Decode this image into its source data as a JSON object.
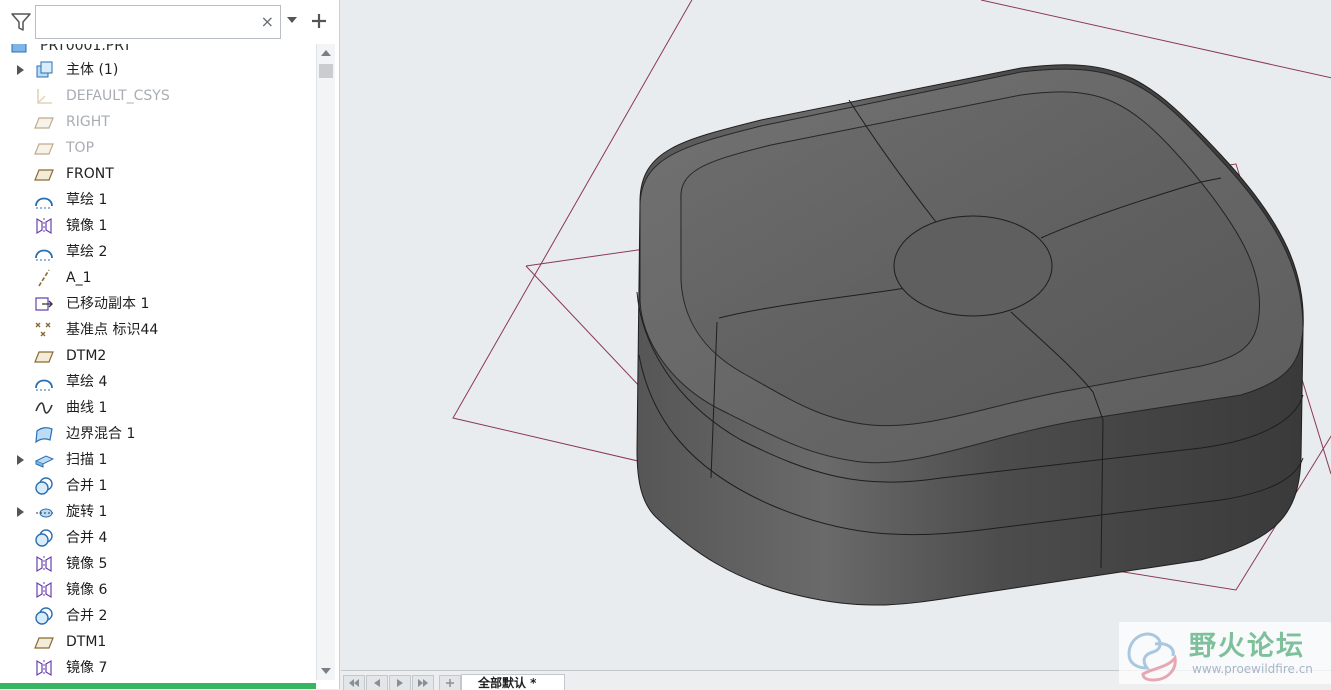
{
  "filter": {
    "search_placeholder": "",
    "clear_glyph": "×"
  },
  "tree": {
    "root_label": "PRT0001.PRT",
    "items": [
      {
        "label": "主体 (1)",
        "icon": "body-icon",
        "expandable": true,
        "dim": false
      },
      {
        "label": "DEFAULT_CSYS",
        "icon": "csys-icon",
        "expandable": false,
        "dim": true
      },
      {
        "label": "RIGHT",
        "icon": "datum-plane-icon",
        "expandable": false,
        "dim": true
      },
      {
        "label": "TOP",
        "icon": "datum-plane-icon",
        "expandable": false,
        "dim": true
      },
      {
        "label": "FRONT",
        "icon": "datum-plane-icon",
        "expandable": false,
        "dim": false
      },
      {
        "label": "草绘 1",
        "icon": "sketch-icon",
        "expandable": false,
        "dim": false
      },
      {
        "label": "镜像 1",
        "icon": "mirror-icon",
        "expandable": false,
        "dim": false
      },
      {
        "label": "草绘 2",
        "icon": "sketch-icon",
        "expandable": false,
        "dim": false
      },
      {
        "label": "A_1",
        "icon": "axis-icon",
        "expandable": false,
        "dim": false
      },
      {
        "label": "已移动副本 1",
        "icon": "moved-copy-icon",
        "expandable": false,
        "dim": false
      },
      {
        "label": "基准点 标识44",
        "icon": "datum-point-icon",
        "expandable": false,
        "dim": false
      },
      {
        "label": "DTM2",
        "icon": "datum-plane-icon",
        "expandable": false,
        "dim": false
      },
      {
        "label": "草绘 4",
        "icon": "sketch-icon",
        "expandable": false,
        "dim": false
      },
      {
        "label": "曲线 1",
        "icon": "curve-icon",
        "expandable": false,
        "dim": false
      },
      {
        "label": "边界混合 1",
        "icon": "boundary-blend-icon",
        "expandable": false,
        "dim": false
      },
      {
        "label": "扫描 1",
        "icon": "sweep-icon",
        "expandable": true,
        "dim": false
      },
      {
        "label": "合并 1",
        "icon": "merge-icon",
        "expandable": false,
        "dim": false
      },
      {
        "label": "旋转 1",
        "icon": "revolve-icon",
        "expandable": true,
        "dim": false
      },
      {
        "label": "合并 4",
        "icon": "merge-icon",
        "expandable": false,
        "dim": false
      },
      {
        "label": "镜像 5",
        "icon": "mirror-icon",
        "expandable": false,
        "dim": false
      },
      {
        "label": "镜像 6",
        "icon": "mirror-icon",
        "expandable": false,
        "dim": false
      },
      {
        "label": "合并 2",
        "icon": "merge-icon",
        "expandable": false,
        "dim": false
      },
      {
        "label": "DTM1",
        "icon": "datum-plane-icon",
        "expandable": false,
        "dim": false
      },
      {
        "label": "镜像 7",
        "icon": "mirror-icon",
        "expandable": false,
        "dim": false
      }
    ]
  },
  "bottom_bar": {
    "view_tab_label": "全部默认 *"
  },
  "watermark": {
    "title": "野火论坛",
    "url": "www.proewildfire.cn"
  },
  "colors": {
    "model_body": "#5a5a5a",
    "datum_plane_edge": "#8a3a52",
    "viewport_background": "#e9ecef",
    "sketch_icon": "#2a6fb3",
    "mirror_icon": "#6a3fb0"
  }
}
